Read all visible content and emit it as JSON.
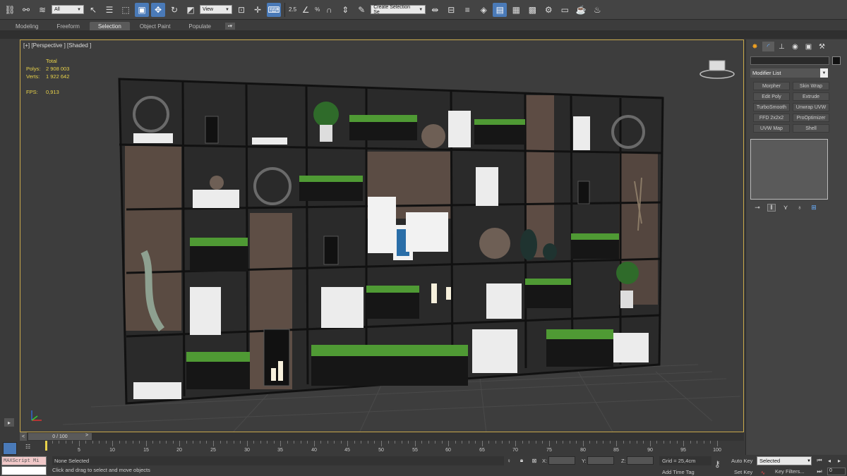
{
  "toolbar": {
    "selection_filter": "All",
    "ref_coord": "View",
    "snap_angle": "2.5",
    "snap_percent": "%",
    "named_selection": "Create Selection Se",
    "icons": [
      "link-icon",
      "unlink-icon",
      "bind-spacewarp-icon",
      "select-object-icon",
      "select-by-name-icon",
      "rect-region-icon",
      "window-crossing-icon",
      "select-move-icon",
      "select-rotate-icon",
      "select-scale-icon",
      "select-place-icon",
      "use-pivot-icon",
      "select-manipulate-icon",
      "keyboard-shortcut-icon",
      "snap-toggle-icon",
      "angle-snap-icon",
      "percent-snap-icon",
      "spinner-snap-icon",
      "edit-named-sel-icon",
      "mirror-icon",
      "align-icon",
      "layer-explorer-icon",
      "ribbon-icon",
      "curve-editor-icon",
      "schematic-view-icon",
      "material-editor-icon",
      "render-setup-icon",
      "rendered-frame-icon",
      "render-icon",
      "render-production-icon"
    ]
  },
  "ribbon": {
    "tabs": [
      "Modeling",
      "Freeform",
      "Selection",
      "Object Paint",
      "Populate"
    ],
    "active": "Selection"
  },
  "viewport": {
    "label": "[+] [Perspective ] [Shaded ]",
    "stats": {
      "header": "Total",
      "polys_label": "Polys:",
      "polys": "2 908 003",
      "verts_label": "Verts:",
      "verts": "1 922 642",
      "fps_label": "FPS:",
      "fps": "0,913"
    }
  },
  "command_panel": {
    "modifier_list": "Modifier List",
    "modifiers": [
      "Morpher",
      "Skin Wrap",
      "Edit Poly",
      "Extrude",
      "TurboSmooth",
      "Unwrap UVW",
      "FFD 2x2x2",
      "ProOptimizer",
      "UVW Map",
      "Shell"
    ]
  },
  "timeline": {
    "frame_display": "0 / 100",
    "ticks": [
      5,
      10,
      15,
      20,
      25,
      30,
      35,
      40,
      45,
      50,
      55,
      60,
      65,
      70,
      75,
      80,
      85,
      90,
      95,
      100
    ]
  },
  "status": {
    "maxscript": "MAXScript Mi",
    "selection": "None Selected",
    "prompt": "Click and drag to select and move objects",
    "x_label": "X:",
    "y_label": "Y:",
    "z_label": "Z:",
    "grid": "Grid = 25,4cm",
    "add_time_tag": "Add Time Tag",
    "auto_key": "Auto Key",
    "set_key": "Set Key",
    "key_mode": "Selected",
    "key_filters": "Key Filters...",
    "frame": "0"
  },
  "colors": {
    "accent": "#4a7ab8",
    "viewport_border": "#c8a84b",
    "stats_text": "#e8d24a"
  }
}
